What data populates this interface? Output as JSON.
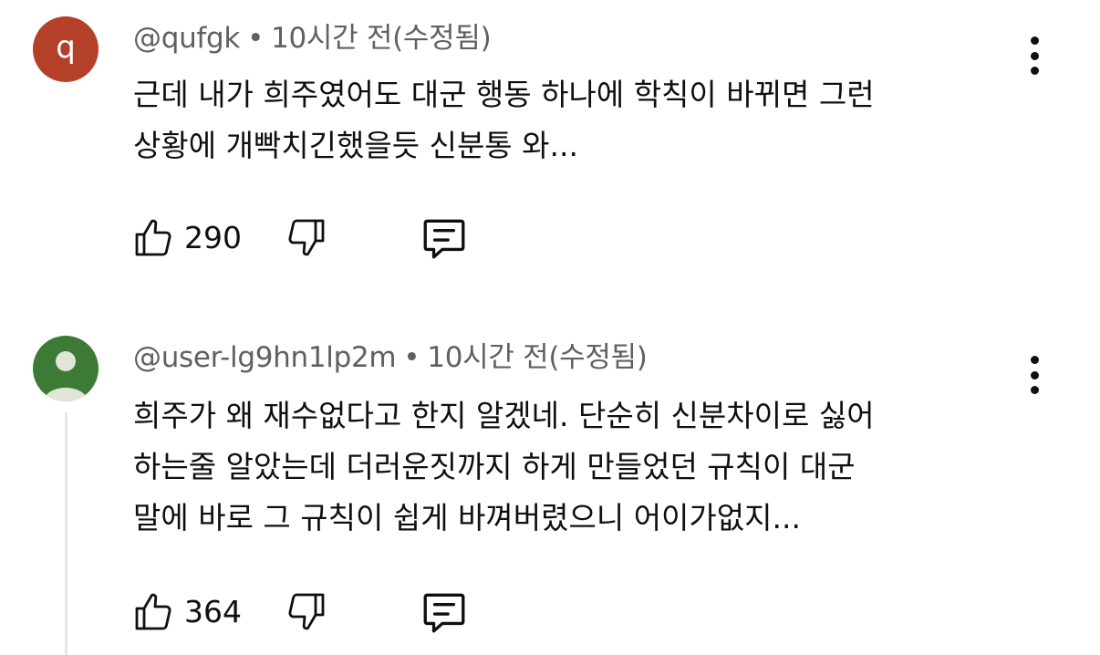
{
  "comments": [
    {
      "avatar": {
        "letter": "q",
        "color": "#b4402a"
      },
      "author": "@qufgk",
      "separator": "•",
      "time": "10시간 전(수정됨)",
      "lines": [
        "근데 내가 희주였어도 대군 행동 하나에 학칙이 바뀌면 그런",
        "상황에 개빡치긴했을듯 신분통 와..."
      ],
      "likes": "290",
      "icons": {
        "like": "thumbs-up-icon",
        "dislike": "thumbs-down-icon",
        "reply": "reply-icon",
        "menu": "more-vert-icon"
      }
    },
    {
      "avatar": {
        "letter": "",
        "color": "#3d7a36"
      },
      "author": "@user-lg9hn1lp2m",
      "separator": "•",
      "time": "10시간 전(수정됨)",
      "lines": [
        "희주가 왜 재수없다고 한지 알겠네. 단순히 신분차이로 싫어",
        "하는줄 알았는데 더러운짓까지 하게 만들었던 규칙이 대군",
        "말에 바로 그 규칙이 쉽게 바껴버렸으니 어이가없지..."
      ],
      "likes": "364",
      "icons": {
        "like": "thumbs-up-icon",
        "dislike": "thumbs-down-icon",
        "reply": "reply-icon",
        "menu": "more-vert-icon"
      }
    }
  ]
}
